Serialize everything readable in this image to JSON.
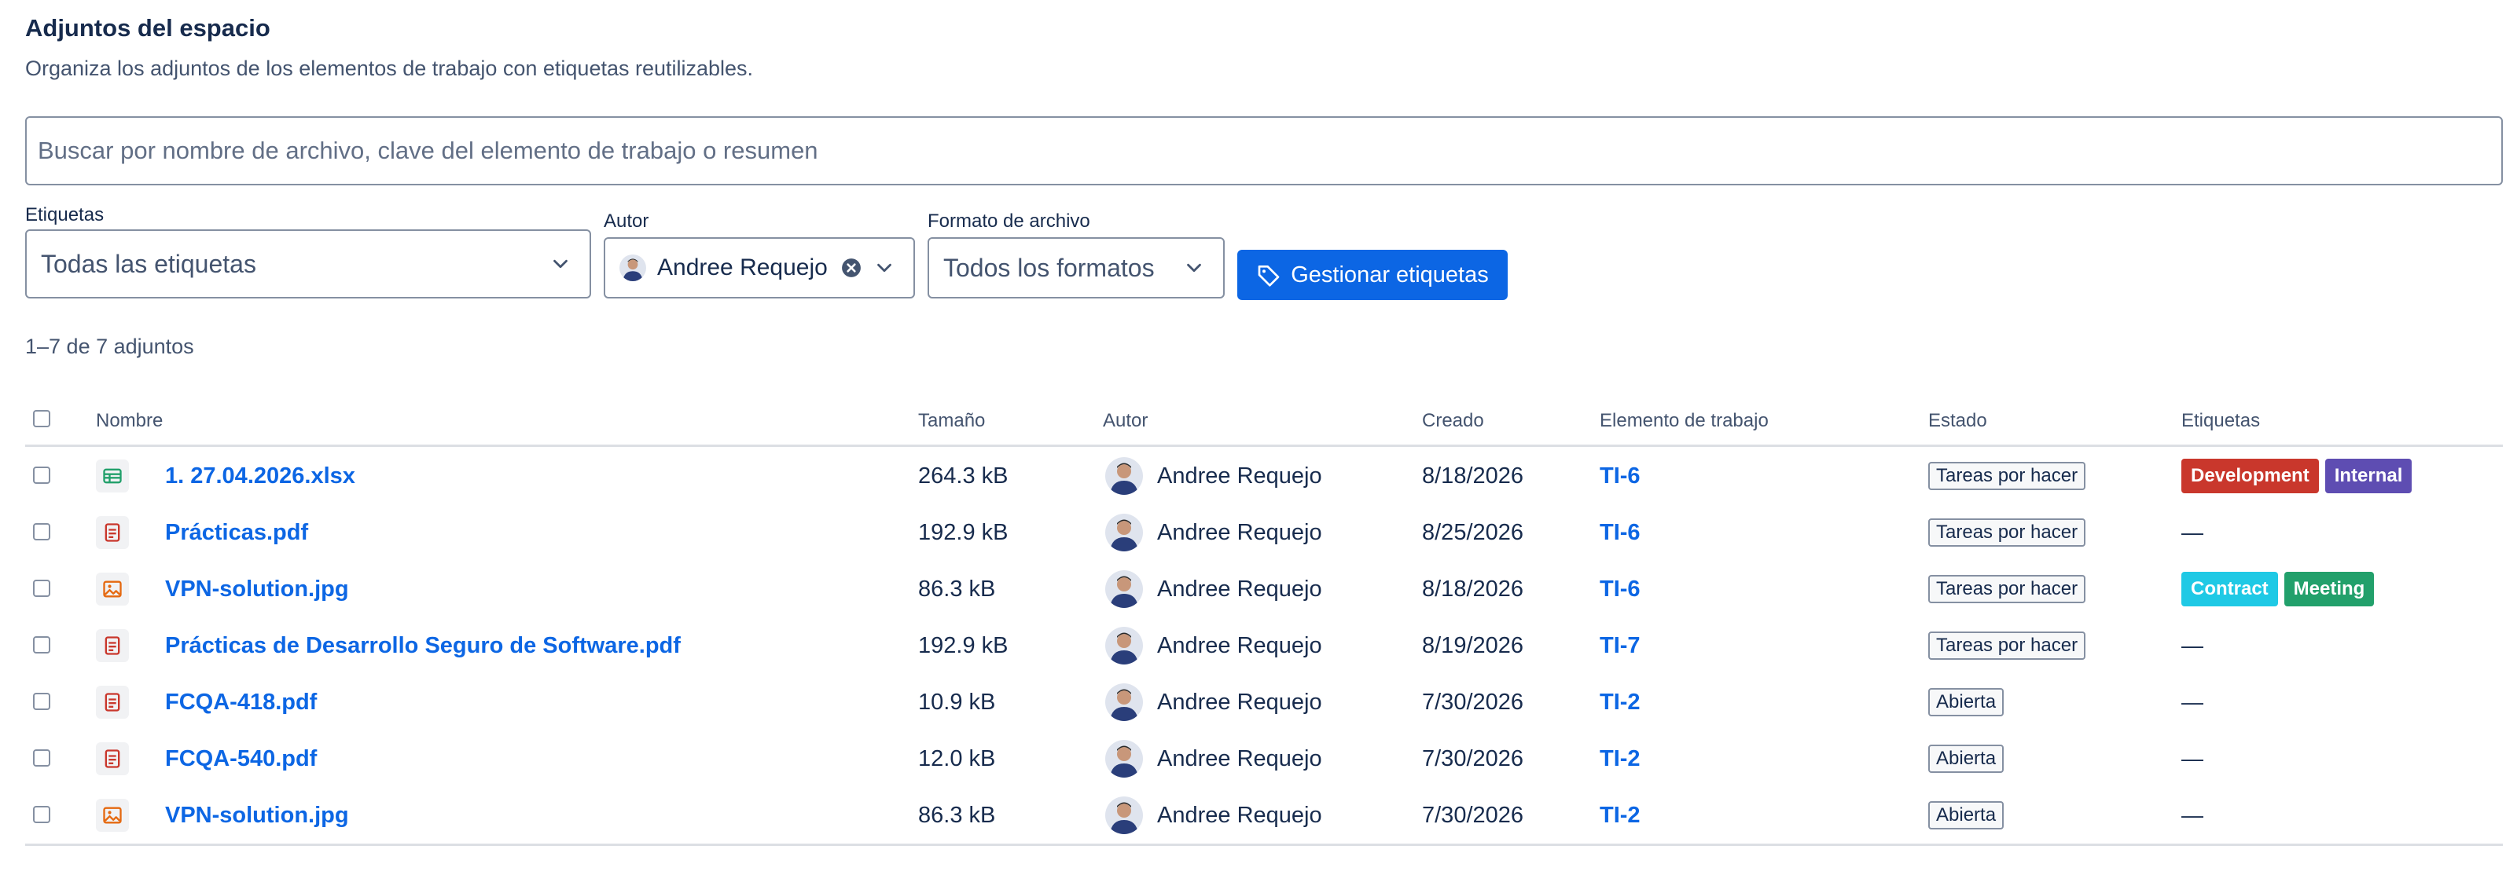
{
  "page": {
    "title": "Adjuntos del espacio",
    "subtitle": "Organiza los adjuntos de los elementos de trabajo con etiquetas reutilizables."
  },
  "search": {
    "placeholder": "Buscar por nombre de archivo, clave del elemento de trabajo o resumen"
  },
  "filters": {
    "labels_label": "Etiquetas",
    "labels_value": "Todas las etiquetas",
    "author_label": "Autor",
    "author_value": "Andree Requejo",
    "format_label": "Formato de archivo",
    "format_value": "Todos los formatos",
    "manage_button": "Gestionar etiquetas"
  },
  "results_count": "1–7 de 7 adjuntos",
  "table": {
    "headers": {
      "name": "Nombre",
      "size": "Tamaño",
      "author": "Autor",
      "created": "Creado",
      "work_item": "Elemento de trabajo",
      "status": "Estado",
      "labels": "Etiquetas"
    },
    "rows": [
      {
        "type": "spreadsheet",
        "name": "1. 27.04.2026.xlsx",
        "size": "264.3 kB",
        "author": "Andree Requejo",
        "created": "8/18/2026",
        "work_item": "TI-6",
        "status": "Tareas por hacer",
        "tags": [
          {
            "label": "Development",
            "color": "#c9372c"
          },
          {
            "label": "Internal",
            "color": "#5e4db2"
          }
        ]
      },
      {
        "type": "pdf",
        "name": "Prácticas.pdf",
        "size": "192.9 kB",
        "author": "Andree Requejo",
        "created": "8/25/2026",
        "work_item": "TI-6",
        "status": "Tareas por hacer",
        "tags": [],
        "empty_tags": "—"
      },
      {
        "type": "image",
        "name": "VPN-solution.jpg",
        "size": "86.3 kB",
        "author": "Andree Requejo",
        "created": "8/18/2026",
        "work_item": "TI-6",
        "status": "Tareas por hacer",
        "tags": [
          {
            "label": "Contract",
            "color": "#1fc9e5"
          },
          {
            "label": "Meeting",
            "color": "#22a06b"
          }
        ]
      },
      {
        "type": "pdf",
        "name": "Prácticas de Desarrollo Seguro de Software.pdf",
        "size": "192.9 kB",
        "author": "Andree Requejo",
        "created": "8/19/2026",
        "work_item": "TI-7",
        "status": "Tareas por hacer",
        "tags": [],
        "empty_tags": "—"
      },
      {
        "type": "pdf",
        "name": "FCQA-418.pdf",
        "size": "10.9 kB",
        "author": "Andree Requejo",
        "created": "7/30/2026",
        "work_item": "TI-2",
        "status": "Abierta",
        "tags": [],
        "empty_tags": "—"
      },
      {
        "type": "pdf",
        "name": "FCQA-540.pdf",
        "size": "12.0 kB",
        "author": "Andree Requejo",
        "created": "7/30/2026",
        "work_item": "TI-2",
        "status": "Abierta",
        "tags": [],
        "empty_tags": "—"
      },
      {
        "type": "image",
        "name": "VPN-solution.jpg",
        "size": "86.3 kB",
        "author": "Andree Requejo",
        "created": "7/30/2026",
        "work_item": "TI-2",
        "status": "Abierta",
        "tags": [],
        "empty_tags": "—"
      }
    ]
  },
  "icons": {
    "spreadsheet": "spreadsheet-file-icon",
    "pdf": "document-file-icon",
    "image": "image-file-icon",
    "chevron": "chevron-down-icon",
    "clear": "clear-icon",
    "tag": "tag-icon"
  }
}
